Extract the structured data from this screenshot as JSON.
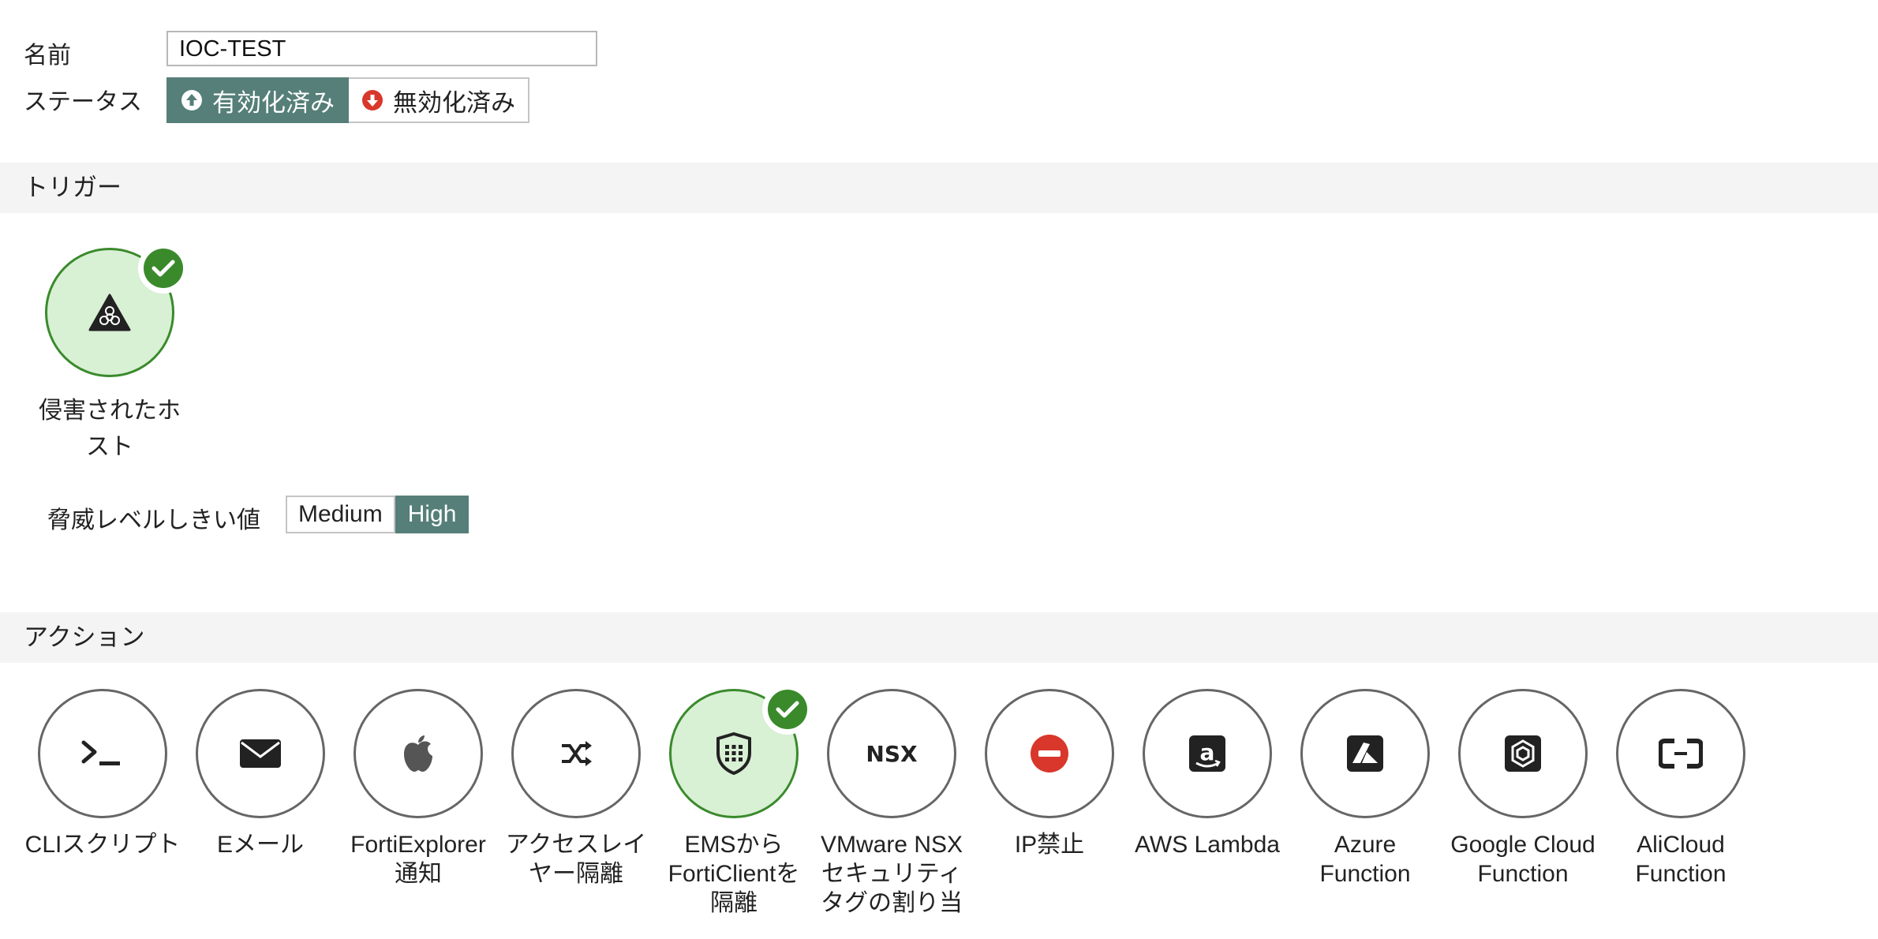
{
  "form": {
    "name_label": "名前",
    "name_value": "IOC-TEST",
    "status_label": "ステータス",
    "status_enabled": "有効化済み",
    "status_disabled": "無効化済み"
  },
  "trigger": {
    "section_title": "トリガー",
    "item_label": "侵害されたホ\nスト",
    "threshold_label": "脅威レベルしきい値",
    "threshold_options": [
      "Medium",
      "High"
    ],
    "threshold_selected": "High"
  },
  "actions": {
    "section_title": "アクション",
    "items": [
      {
        "label": "CLIスクリプト",
        "icon": "terminal-icon",
        "selected": false
      },
      {
        "label": "Eメール",
        "icon": "envelope-icon",
        "selected": false
      },
      {
        "label": "FortiExplorer\n通知",
        "icon": "apple-icon",
        "selected": false
      },
      {
        "label": "アクセスレイ\nヤー隔離",
        "icon": "shuffle-icon",
        "selected": false
      },
      {
        "label": "EMSから\nFortiClientを\n隔離",
        "icon": "fortinet-shield-icon",
        "selected": true
      },
      {
        "label": "VMware NSX\nセキュリティ\nタグの割り当",
        "icon": "nsx-icon",
        "icon_text": "NSX",
        "selected": false
      },
      {
        "label": "IP禁止",
        "icon": "ban-icon",
        "selected": false
      },
      {
        "label": "AWS Lambda",
        "icon": "amazon-icon",
        "selected": false
      },
      {
        "label": "Azure\nFunction",
        "icon": "azure-icon",
        "selected": false
      },
      {
        "label": "Google Cloud\nFunction",
        "icon": "google-cloud-icon",
        "selected": false
      },
      {
        "label": "AliCloud\nFunction",
        "icon": "alicloud-icon",
        "selected": false
      }
    ]
  },
  "colors": {
    "accent": "#557f78",
    "selected_border": "#3a8a2c",
    "selected_fill": "#d8f0d4",
    "ban_red": "#d9372b"
  }
}
